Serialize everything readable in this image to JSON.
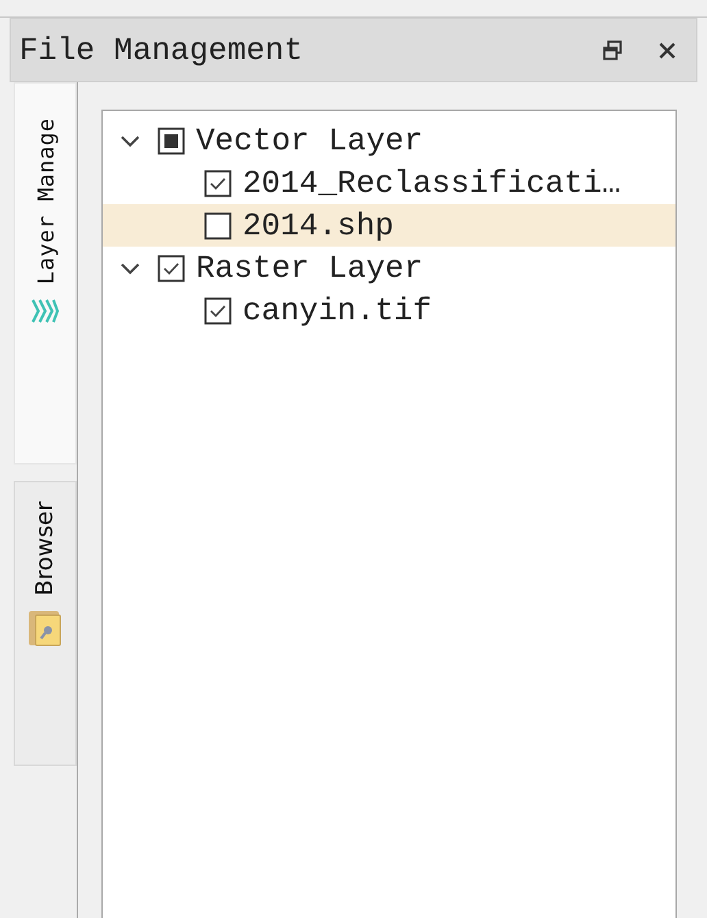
{
  "panel": {
    "title": "File Management"
  },
  "side_tabs": [
    {
      "label": "Layer Manage",
      "selected": true,
      "kind": "layers"
    },
    {
      "label": "Browser",
      "selected": false,
      "kind": "browser"
    }
  ],
  "tree": [
    {
      "label": "Vector Layer",
      "expanded": true,
      "checked": false,
      "partial": true,
      "selected": false,
      "children": [
        {
          "label": "2014_Reclassificati…",
          "checked": true,
          "partial": false,
          "selected": false
        },
        {
          "label": "2014.shp",
          "checked": false,
          "partial": false,
          "selected": true
        }
      ]
    },
    {
      "label": "Raster Layer",
      "expanded": true,
      "checked": true,
      "partial": false,
      "selected": false,
      "children": [
        {
          "label": "canyin.tif",
          "checked": true,
          "partial": false,
          "selected": false
        }
      ]
    }
  ]
}
